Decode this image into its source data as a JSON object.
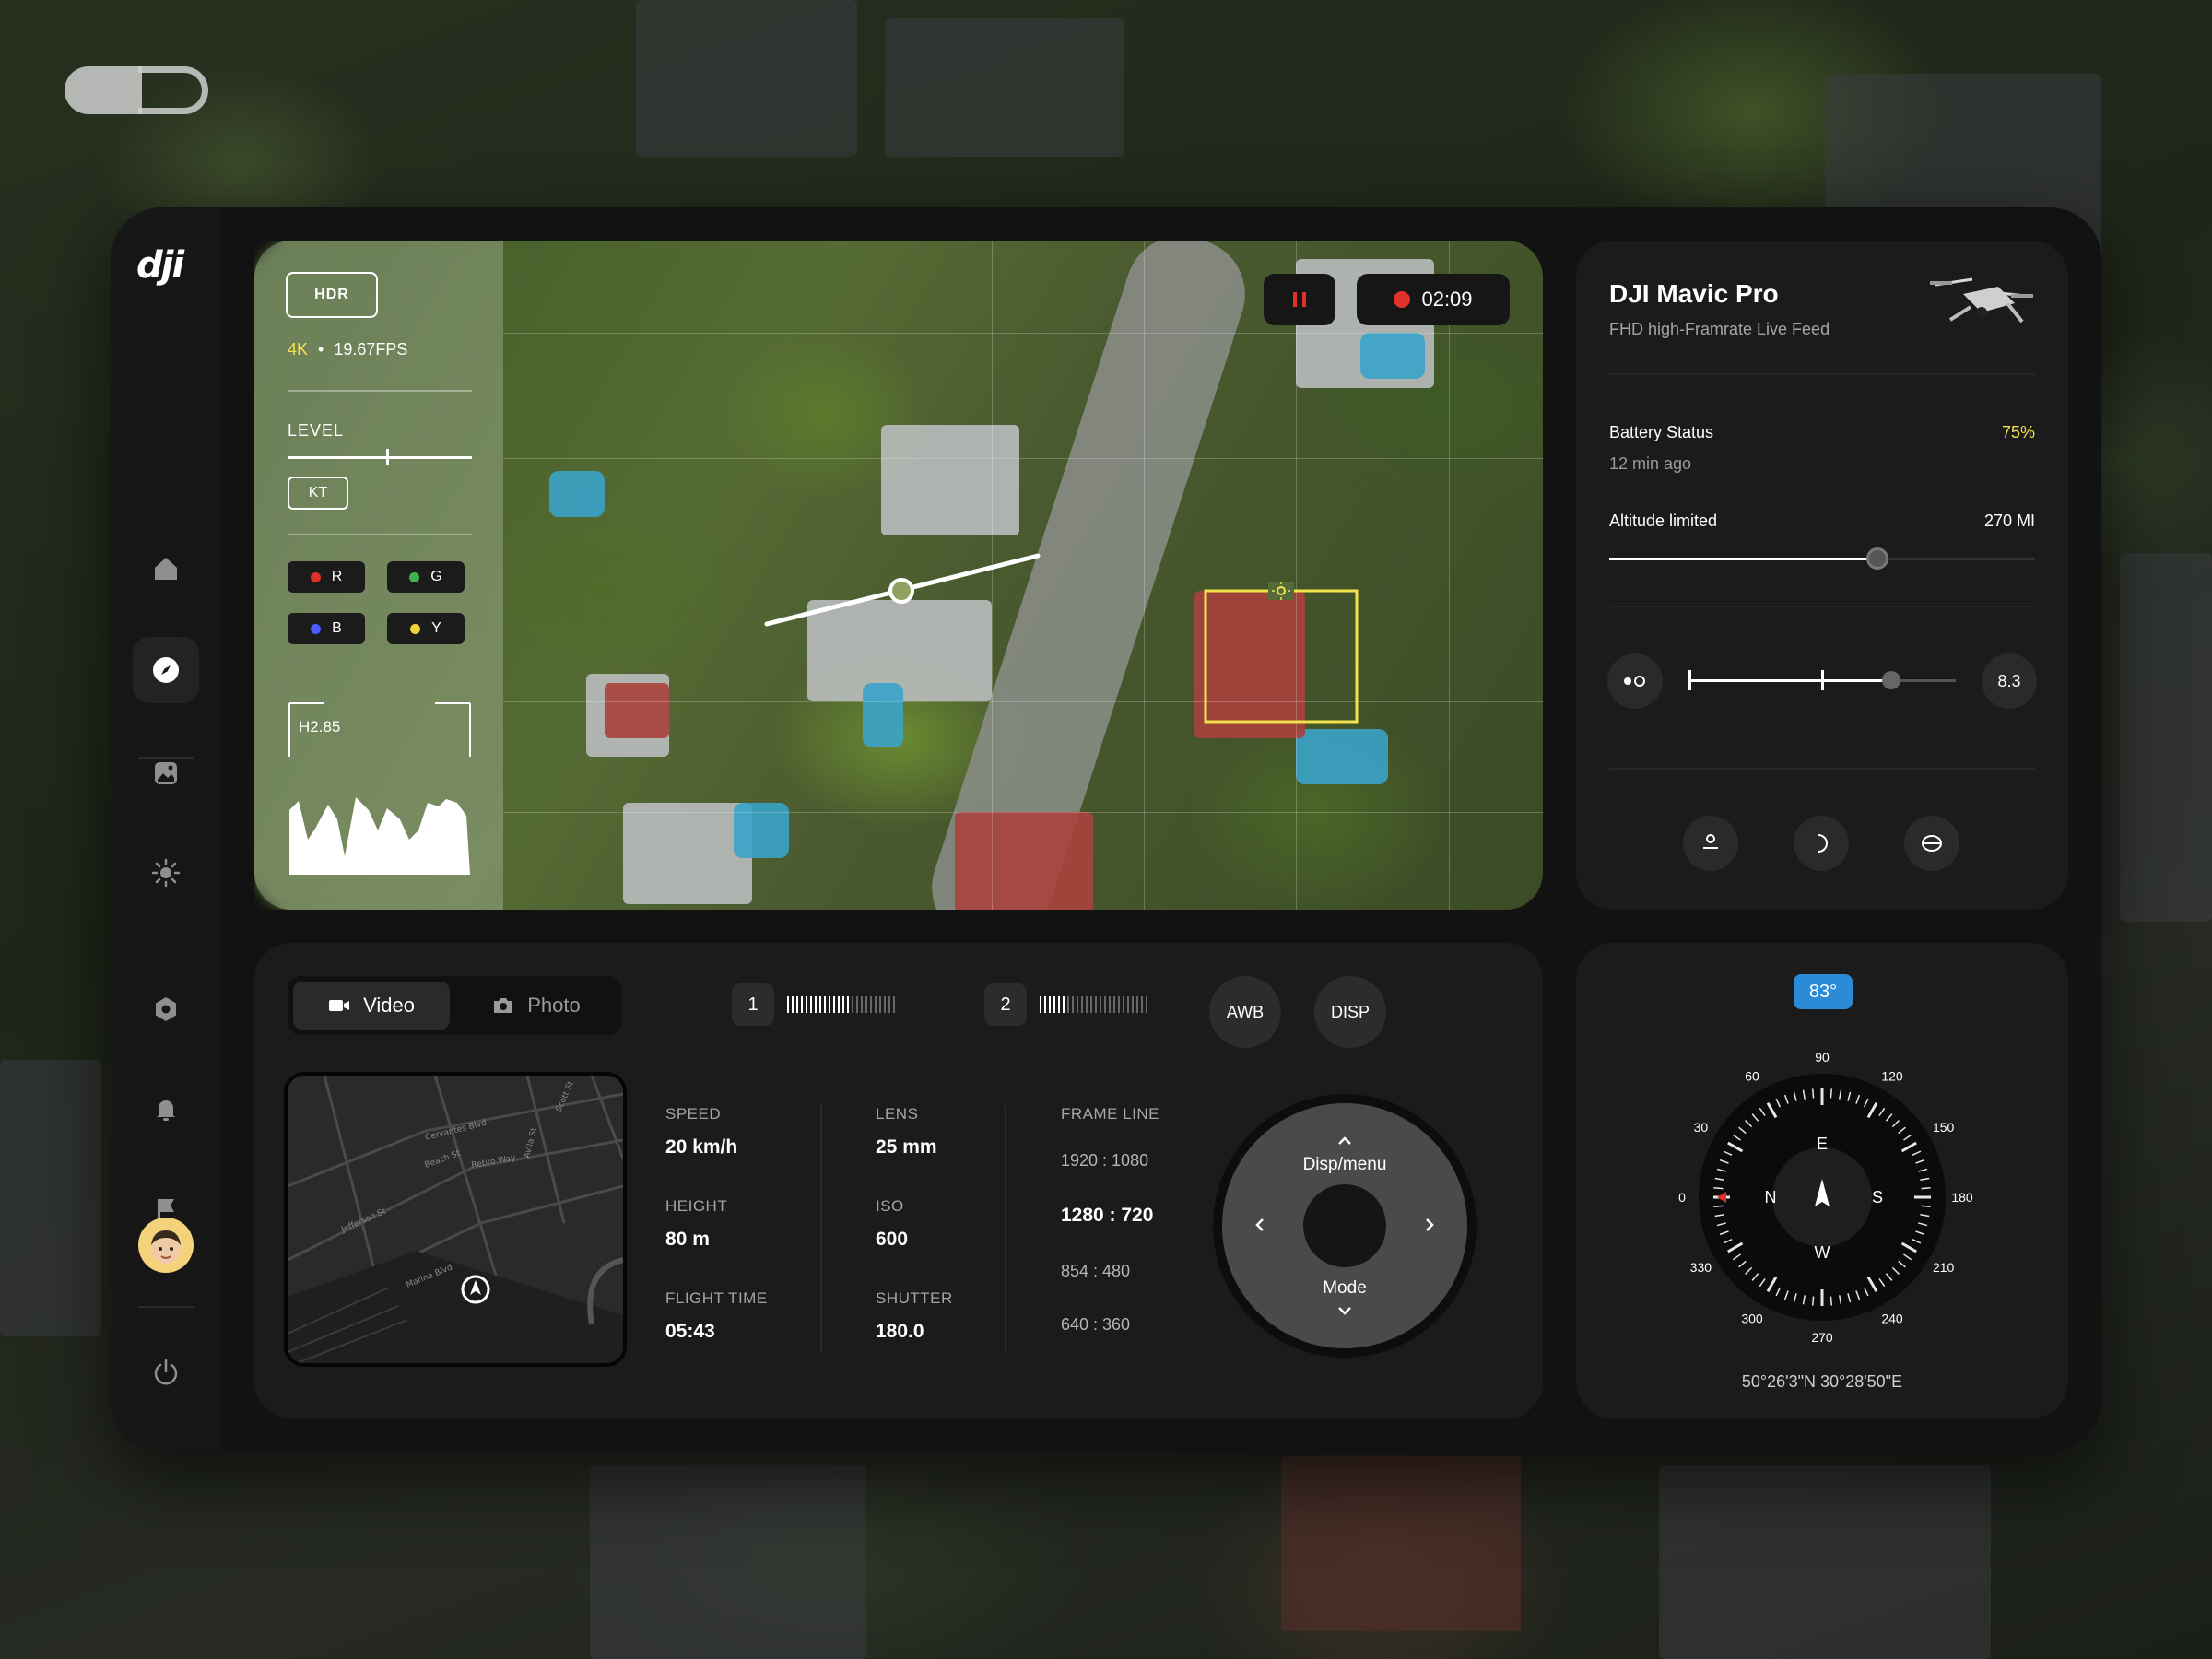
{
  "brand": "dji",
  "camera": {
    "hdr_label": "HDR",
    "resolution": "4K",
    "fps": "19.67FPS",
    "level_label": "LEVEL",
    "kt_label": "KT",
    "channels": [
      {
        "label": "R",
        "color": "#e0312c"
      },
      {
        "label": "G",
        "color": "#3fb34f"
      },
      {
        "label": "B",
        "color": "#4a5cff"
      },
      {
        "label": "Y",
        "color": "#f2d234"
      }
    ],
    "histogram_label": "H2.85",
    "timer": "02:09"
  },
  "drone": {
    "name": "DJI Mavic Pro",
    "subtitle": "FHD high-Framrate Live Feed",
    "battery_label": "Battery Status",
    "battery_value": "75%",
    "battery_sub": "12 min ago",
    "altitude_label": "Altitude limited",
    "altitude_value": "270 MI",
    "altitude_fraction": 0.63,
    "exposure_value": "8.3",
    "exposure_fraction": 0.76
  },
  "controls": {
    "video_label": "Video",
    "photo_label": "Photo",
    "lens1": "1",
    "lens2": "2",
    "lens1_level": 0.6,
    "lens2_level": 0.25,
    "awb_label": "AWB",
    "disp_label": "DISP",
    "stats": {
      "speed_label": "SPEED",
      "speed_value": "20 km/h",
      "height_label": "HEIGHT",
      "height_value": "80 m",
      "flight_label": "FLIGHT TIME",
      "flight_value": "05:43",
      "lens_label": "LENS",
      "lens_value": "25 mm",
      "iso_label": "ISO",
      "iso_value": "600",
      "shutter_label": "SHUTTER",
      "shutter_value": "180.0"
    },
    "frame_line_label": "FRAME LINE",
    "frame_lines": [
      "1920 : 1080",
      "1280 : 720",
      "854 : 480",
      "640 : 360"
    ],
    "frame_selected": "1280 : 720",
    "dpad_top": "Disp/menu",
    "dpad_bottom": "Mode",
    "map_streets": [
      "Cervantes Blvd",
      "Beach St",
      "Jefferson St",
      "Marina Blvd",
      "Retiro Way",
      "Avila St",
      "Scott St"
    ]
  },
  "compass": {
    "heading": "83°",
    "degrees": [
      "0",
      "30",
      "60",
      "90",
      "120",
      "150",
      "180",
      "210",
      "240",
      "270",
      "300",
      "330"
    ],
    "cardinals": {
      "n": "N",
      "e": "E",
      "s": "S",
      "w": "W"
    },
    "coordinates": "50°26'3\"N 30°28'50\"E"
  }
}
